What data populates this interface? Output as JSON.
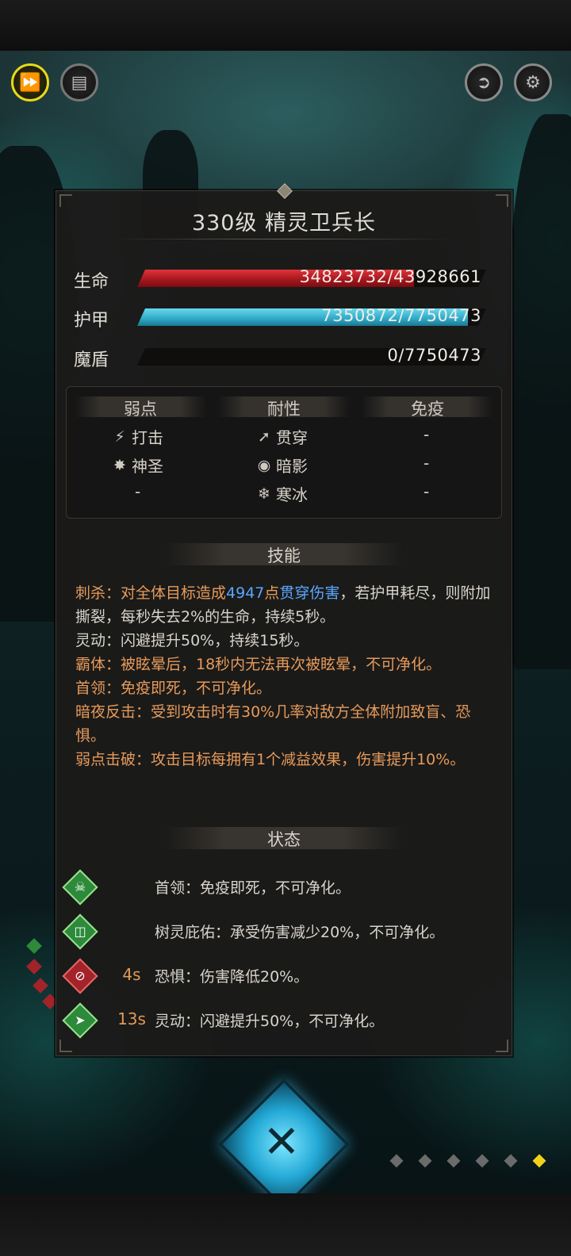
{
  "top_controls": {
    "speed_icon": "fast-forward-icon",
    "auto_icon": "auto-battle-icon",
    "exit_icon": "exit-icon",
    "settings_icon": "gear-icon"
  },
  "monster": {
    "title": "330级  精灵卫兵长"
  },
  "stats": {
    "hp_label": "生命",
    "hp_value": "34823732/43928661",
    "hp_fraction": 0.793,
    "armor_label": "护甲",
    "armor_value": "7350872/7750473",
    "armor_fraction": 0.948,
    "shield_label": "魔盾",
    "shield_value": "0/7750473",
    "shield_fraction": 0
  },
  "resistances": {
    "weak_header": "弱点",
    "resist_header": "耐性",
    "immune_header": "免疫",
    "weak": [
      {
        "icon": "strike-icon",
        "label": "打击"
      },
      {
        "icon": "holy-icon",
        "label": "神圣"
      },
      {
        "icon": "",
        "label": "-"
      }
    ],
    "resist": [
      {
        "icon": "pierce-icon",
        "label": "贯穿"
      },
      {
        "icon": "shadow-icon",
        "label": "暗影"
      },
      {
        "icon": "frost-icon",
        "label": "寒冰"
      }
    ],
    "immune": [
      "-",
      "-",
      "-"
    ]
  },
  "skills": {
    "header": "技能",
    "s1_a": "刺杀：对全体目标造成",
    "s1_num": "4947",
    "s1_b": "点",
    "s1_type": "贯穿伤害",
    "s1_c": "，若护甲耗尽，则附加撕裂，每秒失去2%的生命，持续5秒。",
    "s2": "灵动：闪避提升50%，持续15秒。",
    "s3": "霸体：被眩晕后，18秒内无法再次被眩晕，不可净化。",
    "s4": "首领：免疫即死，不可净化。",
    "s5": "暗夜反击：受到攻击时有30%几率对敌方全体附加致盲、恐惧。",
    "s6": "弱点击破：攻击目标每拥有1个减益效果，伤害提升10%。"
  },
  "status": {
    "header": "状态",
    "items": [
      {
        "icon": "skull-icon",
        "time": "",
        "text": "首领：免疫即死，不可净化。",
        "color": "green"
      },
      {
        "icon": "shield-icon",
        "time": "",
        "text": "树灵庇佑：承受伤害减少20%，不可净化。",
        "color": "green"
      },
      {
        "icon": "fear-icon",
        "time": "4s",
        "text": "恐惧：伤害降低20%。",
        "color": "red"
      },
      {
        "icon": "boot-icon",
        "time": "13s",
        "text": "灵动：闪避提升50%，不可净化。",
        "color": "green"
      }
    ]
  },
  "close_icon": "close-icon",
  "pages": {
    "count": 6,
    "active": 5
  }
}
